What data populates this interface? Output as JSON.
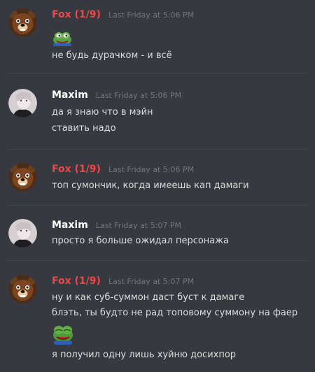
{
  "colors": {
    "fox": "#f04747",
    "maxim": "#ffffff",
    "background": "#36393f"
  },
  "messages": [
    {
      "author": "Fox (1/9)",
      "author_color": "#f04747",
      "avatar": "bear-avatar",
      "timestamp": "Last Friday at 5:06 PM",
      "emoji": "pepe-frog-emoji",
      "lines": [
        "не будь дурачком - и всё"
      ]
    },
    {
      "author": "Maxim",
      "author_color": "#ffffff",
      "avatar": "user-photo-avatar",
      "timestamp": "Last Friday at 5:06 PM",
      "lines": [
        "да я знаю что в мэйн",
        "ставить надо"
      ]
    },
    {
      "author": "Fox (1/9)",
      "author_color": "#f04747",
      "avatar": "bear-avatar",
      "timestamp": "Last Friday at 5:06 PM",
      "lines": [
        "топ сумончик, когда имеешь кап дамаги"
      ]
    },
    {
      "author": "Maxim",
      "author_color": "#ffffff",
      "avatar": "user-photo-avatar",
      "timestamp": "Last Friday at 5:07 PM",
      "lines": [
        "просто я больше ожидал персонажа"
      ]
    },
    {
      "author": "Fox (1/9)",
      "author_color": "#f04747",
      "avatar": "bear-avatar",
      "timestamp": "Last Friday at 5:07 PM",
      "lines": [
        "ну и как суб-суммон даст буст к дамаге",
        "блэть, ты будто не рад топовому суммону на фаер"
      ],
      "emoji": "pepe-frog-emoji",
      "after_emoji_line": "я получил одну лишь хуйню досихпор"
    }
  ]
}
